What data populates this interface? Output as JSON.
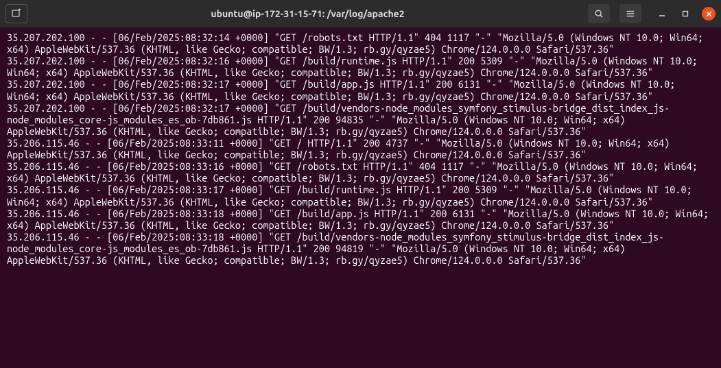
{
  "window": {
    "title": "ubuntu@ip-172-31-15-71: /var/log/apache2"
  },
  "icons": {
    "new_tab": "new-tab-icon",
    "search": "search-icon",
    "menu": "hamburger-icon",
    "minimize": "minimize-icon",
    "maximize": "maximize-icon",
    "close": "close-icon"
  },
  "log_lines": [
    "35.207.202.100 - - [06/Feb/2025:08:32:14 +0000] \"GET /robots.txt HTTP/1.1\" 404 1117 \"-\" \"Mozilla/5.0 (Windows NT 10.0; Win64; x64) AppleWebKit/537.36 (KHTML, like Gecko; compatible; BW/1.3; rb.gy/qyzae5) Chrome/124.0.0.0 Safari/537.36\"",
    "35.207.202.100 - - [06/Feb/2025:08:32:16 +0000] \"GET /build/runtime.js HTTP/1.1\" 200 5309 \"-\" \"Mozilla/5.0 (Windows NT 10.0; Win64; x64) AppleWebKit/537.36 (KHTML, like Gecko; compatible; BW/1.3; rb.gy/qyzae5) Chrome/124.0.0.0 Safari/537.36\"",
    "35.207.202.100 - - [06/Feb/2025:08:32:17 +0000] \"GET /build/app.js HTTP/1.1\" 200 6131 \"-\" \"Mozilla/5.0 (Windows NT 10.0; Win64; x64) AppleWebKit/537.36 (KHTML, like Gecko; compatible; BW/1.3; rb.gy/qyzae5) Chrome/124.0.0.0 Safari/537.36\"",
    "35.207.202.100 - - [06/Feb/2025:08:32:17 +0000] \"GET /build/vendors-node_modules_symfony_stimulus-bridge_dist_index_js-node_modules_core-js_modules_es_ob-7db861.js HTTP/1.1\" 200 94835 \"-\" \"Mozilla/5.0 (Windows NT 10.0; Win64; x64) AppleWebKit/537.36 (KHTML, like Gecko; compatible; BW/1.3; rb.gy/qyzae5) Chrome/124.0.0.0 Safari/537.36\"",
    "35.206.115.46 - - [06/Feb/2025:08:33:11 +0000] \"GET / HTTP/1.1\" 200 4737 \"-\" \"Mozilla/5.0 (Windows NT 10.0; Win64; x64) AppleWebKit/537.36 (KHTML, like Gecko; compatible; BW/1.3; rb.gy/qyzae5) Chrome/124.0.0.0 Safari/537.36\"",
    "35.206.115.46 - - [06/Feb/2025:08:33:16 +0000] \"GET /robots.txt HTTP/1.1\" 404 1117 \"-\" \"Mozilla/5.0 (Windows NT 10.0; Win64; x64) AppleWebKit/537.36 (KHTML, like Gecko; compatible; BW/1.3; rb.gy/qyzae5) Chrome/124.0.0.0 Safari/537.36\"",
    "35.206.115.46 - - [06/Feb/2025:08:33:17 +0000] \"GET /build/runtime.js HTTP/1.1\" 200 5309 \"-\" \"Mozilla/5.0 (Windows NT 10.0; Win64; x64) AppleWebKit/537.36 (KHTML, like Gecko; compatible; BW/1.3; rb.gy/qyzae5) Chrome/124.0.0.0 Safari/537.36\"",
    "35.206.115.46 - - [06/Feb/2025:08:33:18 +0000] \"GET /build/app.js HTTP/1.1\" 200 6131 \"-\" \"Mozilla/5.0 (Windows NT 10.0; Win64; x64) AppleWebKit/537.36 (KHTML, like Gecko; compatible; BW/1.3; rb.gy/qyzae5) Chrome/124.0.0.0 Safari/537.36\"",
    "35.206.115.46 - - [06/Feb/2025:08:33:18 +0000] \"GET /build/vendors-node_modules_symfony_stimulus-bridge_dist_index_js-node_modules_core-js_modules_es_ob-7db861.js HTTP/1.1\" 200 94819 \"-\" \"Mozilla/5.0 (Windows NT 10.0; Win64; x64) AppleWebKit/537.36 (KHTML, like Gecko; compatible; BW/1.3; rb.gy/qyzae5) Chrome/124.0.0.0 Safari/537.36\""
  ]
}
